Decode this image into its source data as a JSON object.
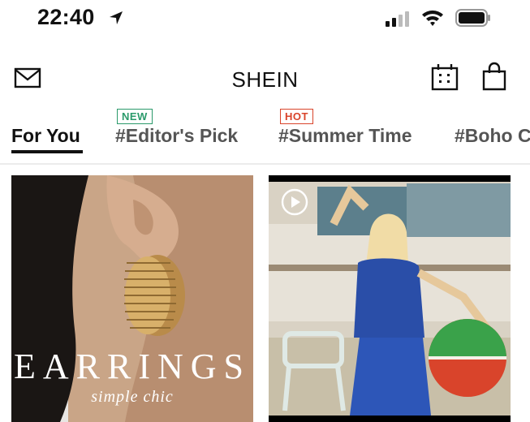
{
  "status_bar": {
    "time": "22:40",
    "icons": [
      "location-arrow-icon",
      "cellular-signal-icon",
      "wifi-icon",
      "battery-icon"
    ]
  },
  "header": {
    "title": "SHEIN",
    "icons": [
      "mail-icon",
      "calendar-icon",
      "shopping-bag-icon"
    ]
  },
  "tabs": {
    "items": [
      {
        "label": "For You",
        "active": true,
        "badge": ""
      },
      {
        "label": "#Editor's Pick",
        "active": false,
        "badge": "NEW"
      },
      {
        "label": "#Summer Time",
        "active": false,
        "badge": "HOT"
      },
      {
        "label": "#Boho C",
        "active": false,
        "badge": ""
      }
    ]
  },
  "feed": {
    "cards": [
      {
        "title": "EARRINGS",
        "subtitle": "simple chic",
        "kind": "image"
      },
      {
        "title": "",
        "subtitle": "",
        "kind": "video",
        "icon": "play-icon"
      }
    ]
  },
  "colors": {
    "badge_new": "#2b9a6b",
    "badge_hot": "#d9442b",
    "active_tab": "#111111",
    "inactive_tab": "#555555"
  }
}
